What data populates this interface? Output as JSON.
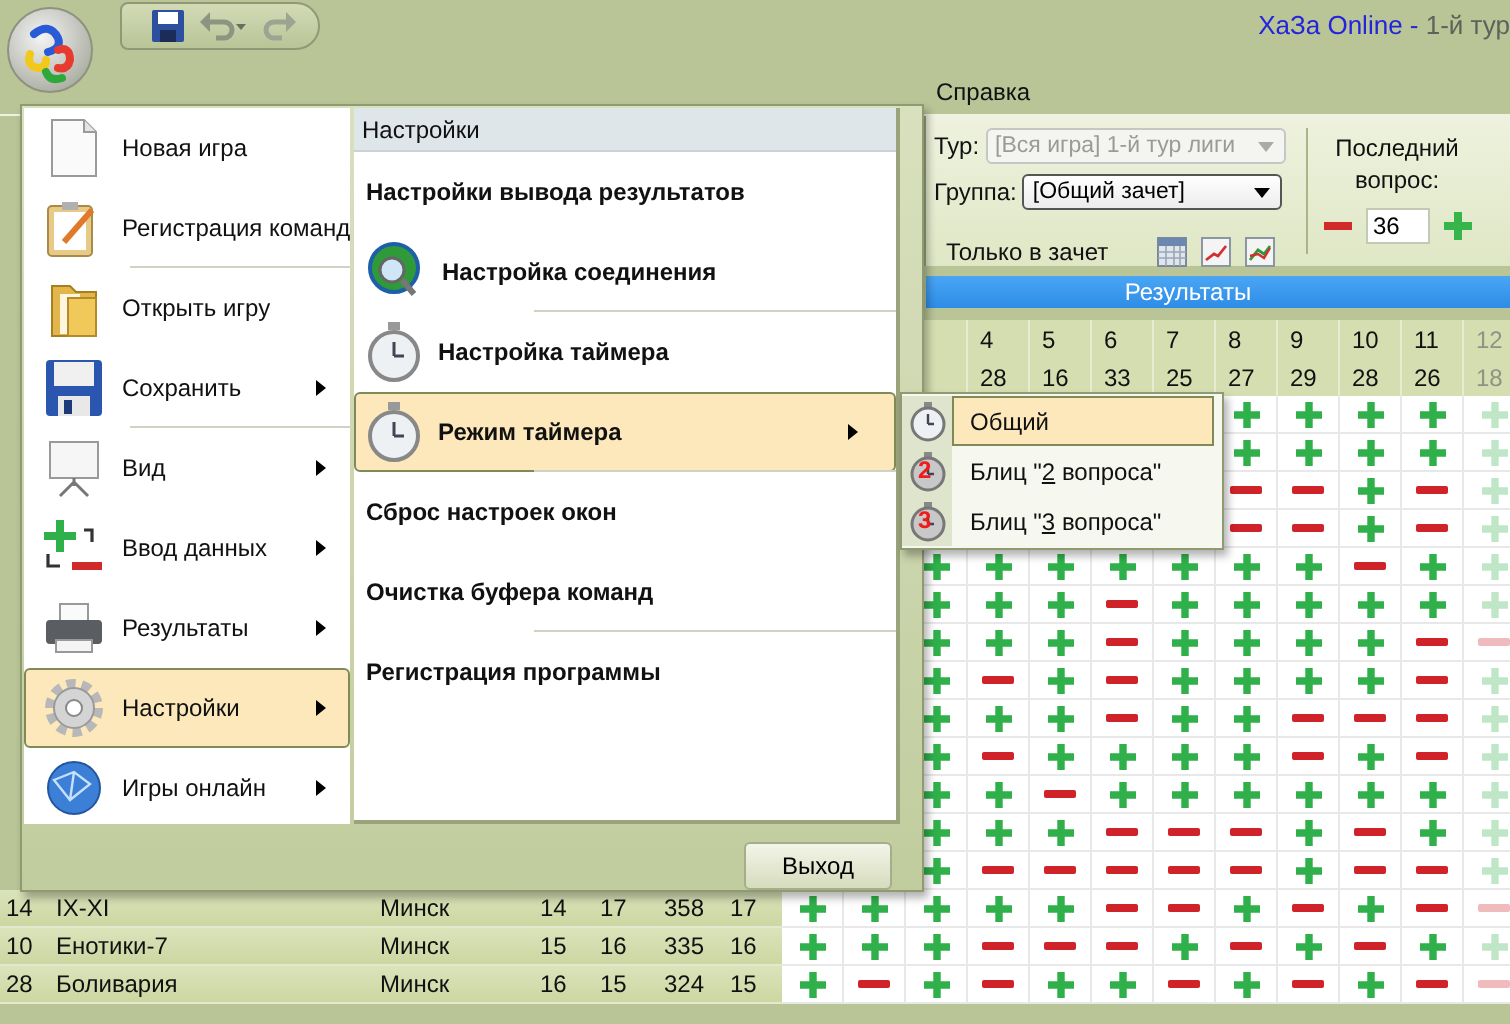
{
  "window": {
    "title_app": "ХаЗа Online -",
    "title_document": "1-й тур"
  },
  "ribbon": {
    "tabs": [
      "Справка"
    ],
    "tour": {
      "label": "Тур:",
      "value": "[Вся игра] 1-й тур лиги",
      "disabled": true
    },
    "group": {
      "label": "Группа:",
      "value": "[Общий зачет]",
      "disabled": false
    },
    "only_scored": "Только в зачет",
    "last_question": {
      "label": "Последний вопрос:",
      "value": "36"
    },
    "section": "Результаты"
  },
  "results": {
    "question_numbers": [
      "4",
      "5",
      "6",
      "7",
      "8",
      "9",
      "10",
      "11",
      "12"
    ],
    "question_counts": [
      "28",
      "16",
      "33",
      "25",
      "27",
      "29",
      "28",
      "26",
      "18"
    ],
    "rows": [
      {
        "kind": "covered_by_submenu",
        "answers": [
          true,
          true,
          true,
          true,
          true
        ]
      },
      {
        "kind": "covered_by_submenu",
        "answers": [
          true,
          true,
          true,
          true,
          true
        ]
      },
      {
        "kind": "covered_by_submenu",
        "answers": [
          false,
          false,
          true,
          false,
          true
        ]
      },
      {
        "kind": "covered_by_submenu",
        "answers": [
          false,
          false,
          true,
          false,
          true
        ]
      },
      {
        "kind": "covered_by_menu",
        "answers": [
          true,
          true,
          true,
          true,
          true,
          true,
          true,
          false,
          true,
          true
        ]
      },
      {
        "kind": "covered_by_menu",
        "answers": [
          true,
          true,
          true,
          false,
          true,
          true,
          true,
          true,
          true,
          true
        ]
      },
      {
        "kind": "covered_by_menu",
        "answers": [
          true,
          true,
          true,
          false,
          true,
          true,
          true,
          true,
          false,
          false
        ]
      },
      {
        "kind": "covered_by_menu",
        "answers": [
          true,
          false,
          true,
          false,
          true,
          true,
          true,
          true,
          false,
          true
        ]
      },
      {
        "kind": "covered_by_menu",
        "answers": [
          true,
          true,
          true,
          false,
          true,
          true,
          false,
          false,
          false,
          true
        ]
      },
      {
        "kind": "covered_by_menu",
        "answers": [
          true,
          false,
          true,
          true,
          true,
          true,
          false,
          true,
          false,
          true
        ]
      },
      {
        "kind": "covered_by_menu",
        "answers": [
          true,
          true,
          false,
          true,
          true,
          true,
          true,
          true,
          true,
          true
        ]
      },
      {
        "kind": "covered_by_menu",
        "answers": [
          true,
          true,
          true,
          false,
          false,
          false,
          true,
          false,
          true,
          true
        ]
      },
      {
        "kind": "covered_by_menu",
        "answers": [
          true,
          false,
          false,
          false,
          false,
          false,
          true,
          false,
          false,
          true
        ]
      },
      {
        "kind": "team",
        "place": "14",
        "team": "IX-XI",
        "city": "Минск",
        "stats": [
          "14",
          "17",
          "358",
          "17"
        ],
        "answers": [
          true,
          true,
          true,
          true,
          true,
          false,
          false,
          true,
          false,
          true,
          false,
          false
        ]
      },
      {
        "kind": "team",
        "place": "10",
        "team": "Енотики-7",
        "city": "Минск",
        "stats": [
          "15",
          "16",
          "335",
          "16"
        ],
        "answers": [
          true,
          true,
          true,
          false,
          false,
          false,
          true,
          false,
          true,
          false,
          true,
          true
        ]
      },
      {
        "kind": "team",
        "place": "28",
        "team": "Боливария",
        "city": "Минск",
        "stats": [
          "16",
          "15",
          "324",
          "15"
        ],
        "answers": [
          true,
          false,
          true,
          false,
          true,
          true,
          false,
          true,
          false,
          true,
          false,
          false
        ]
      }
    ]
  },
  "app_menu": {
    "items": [
      {
        "label": "Новая игра",
        "submenu": false,
        "selected": false,
        "separator_after": false
      },
      {
        "label": "Регистрация команд",
        "submenu": false,
        "selected": false,
        "separator_after": true
      },
      {
        "label": "Открыть игру",
        "submenu": false,
        "selected": false,
        "separator_after": false
      },
      {
        "label": "Сохранить",
        "submenu": true,
        "selected": false,
        "separator_after": true
      },
      {
        "label": "Вид",
        "submenu": true,
        "selected": false,
        "separator_after": false
      },
      {
        "label": "Ввод данных",
        "submenu": true,
        "selected": false,
        "separator_after": false
      },
      {
        "label": "Результаты",
        "submenu": true,
        "selected": false,
        "separator_after": false
      },
      {
        "label": "Настройки",
        "submenu": true,
        "selected": true,
        "separator_after": false
      },
      {
        "label": "Игры онлайн",
        "submenu": true,
        "selected": false,
        "separator_after": false
      }
    ],
    "panel": {
      "title": "Настройки",
      "items": [
        {
          "label": "Настройки вывода результатов",
          "submenu": false,
          "selected": false,
          "separator_after": false
        },
        {
          "label": "Настройка соединения",
          "submenu": false,
          "selected": false,
          "separator_after": true
        },
        {
          "label": "Настройка таймера",
          "submenu": false,
          "selected": false,
          "separator_after": false
        },
        {
          "label": "Режим таймера",
          "submenu": true,
          "selected": true,
          "separator_after": true
        },
        {
          "label": "Сброс настроек окон",
          "submenu": false,
          "selected": false,
          "separator_after": false
        },
        {
          "label": "Очистка буфера команд",
          "submenu": false,
          "selected": false,
          "separator_after": true
        },
        {
          "label": "Регистрация программы",
          "submenu": false,
          "selected": false,
          "separator_after": false
        }
      ]
    },
    "exit_button": "Выход"
  },
  "submenu": {
    "items": [
      {
        "label_parts": [
          "Общий"
        ],
        "selected": true
      },
      {
        "label_parts": [
          "Блиц \"",
          "2",
          " вопроса\""
        ],
        "icon_badge": "2",
        "selected": false
      },
      {
        "label_parts": [
          "Блиц \"",
          "3",
          " вопроса\""
        ],
        "icon_badge": "3",
        "selected": false
      }
    ]
  }
}
